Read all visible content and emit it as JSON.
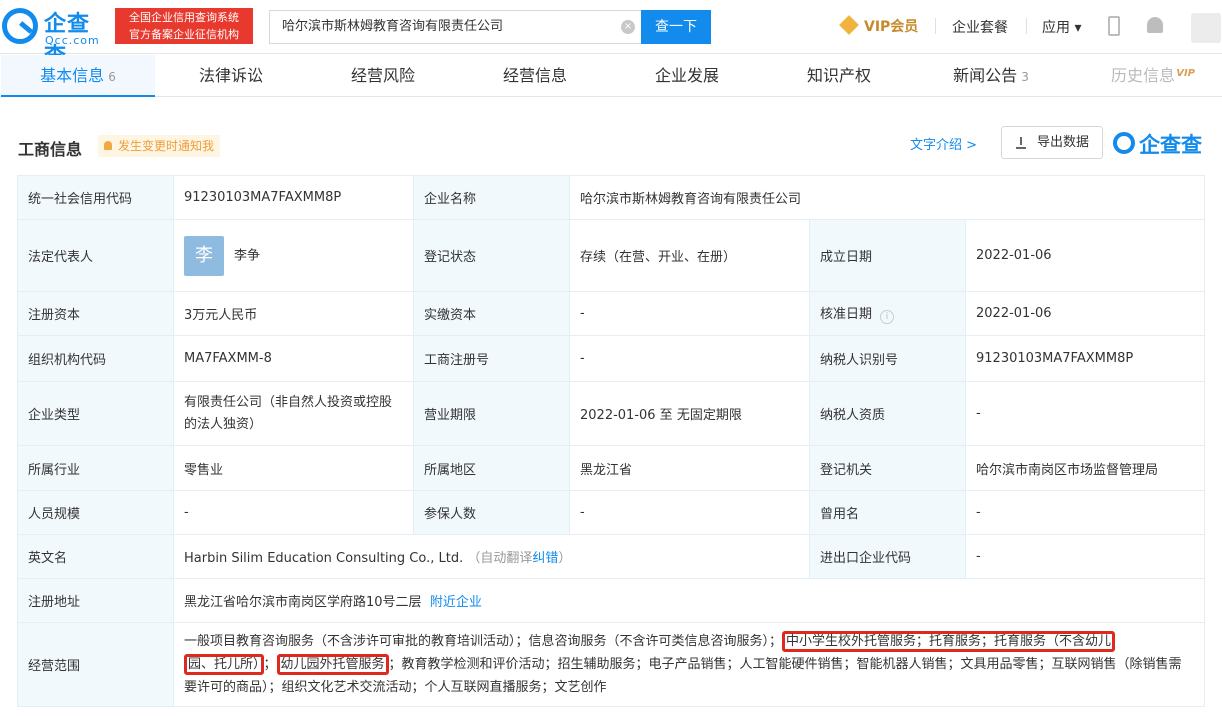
{
  "header": {
    "logo_title": "企查查",
    "logo_sub": "Qcc.com",
    "badge_line1": "全国企业信用查询系统",
    "badge_line2": "官方备案企业征信机构",
    "search_value": "哈尔滨市斯林姆教育咨询有限责任公司",
    "search_button": "查一下",
    "vip_label": "VIP会员",
    "enterprise_suite": "企业套餐",
    "apps": "应用 ▾"
  },
  "tabs": [
    {
      "label": "基本信息",
      "count": "6"
    },
    {
      "label": "法律诉讼",
      "count": ""
    },
    {
      "label": "经营风险",
      "count": ""
    },
    {
      "label": "经营信息",
      "count": ""
    },
    {
      "label": "企业发展",
      "count": ""
    },
    {
      "label": "知识产权",
      "count": ""
    },
    {
      "label": "新闻公告",
      "count": "3"
    },
    {
      "label": "历史信息",
      "count": "",
      "tag": "VIP"
    }
  ],
  "section": {
    "title": "工商信息",
    "notify": "发生变更时通知我",
    "text_intro": "文字介绍 >",
    "export": "导出数据",
    "brand": "企查查"
  },
  "info": {
    "credit_code_label": "统一社会信用代码",
    "credit_code": "91230103MA7FAXMM8P",
    "company_name_label": "企业名称",
    "company_name": "哈尔滨市斯林姆教育咨询有限责任公司",
    "legal_rep_label": "法定代表人",
    "legal_rep_avatar": "李",
    "legal_rep": "李争",
    "reg_status_label": "登记状态",
    "reg_status": "存续（在营、开业、在册）",
    "founded_label": "成立日期",
    "founded": "2022-01-06",
    "reg_capital_label": "注册资本",
    "reg_capital": "3万元人民币",
    "paid_capital_label": "实缴资本",
    "paid_capital": "-",
    "approval_date_label": "核准日期",
    "approval_date": "2022-01-06",
    "org_code_label": "组织机构代码",
    "org_code": "MA7FAXMM-8",
    "biz_reg_no_label": "工商注册号",
    "biz_reg_no": "-",
    "taxpayer_id_label": "纳税人识别号",
    "taxpayer_id": "91230103MA7FAXMM8P",
    "company_type_label": "企业类型",
    "company_type": "有限责任公司（非自然人投资或控股的法人独资）",
    "term_label": "营业期限",
    "term": "2022-01-06 至 无固定期限",
    "taxpayer_qual_label": "纳税人资质",
    "taxpayer_qual": "-",
    "industry_label": "所属行业",
    "industry": "零售业",
    "region_label": "所属地区",
    "region": "黑龙江省",
    "authority_label": "登记机关",
    "authority": "哈尔滨市南岗区市场监督管理局",
    "staff_label": "人员规模",
    "staff": "-",
    "insured_label": "参保人数",
    "insured": "-",
    "former_name_label": "曾用名",
    "former_name": "-",
    "english_label": "英文名",
    "english": "Harbin Silim Education Consulting Co., Ltd.",
    "auto_translate": "（自动翻译",
    "correct": "纠错",
    "auto_translate_close": "）",
    "ie_code_label": "进出口企业代码",
    "ie_code": "-",
    "address_label": "注册地址",
    "address": "黑龙江省哈尔滨市南岗区学府路10号二层",
    "nearby": "附近企业",
    "scope_label": "经营范围",
    "scope_a": "一般项目教育咨询服务（不含涉许可审批的教育培训活动）；信息咨询服务（不含许可类信息咨询服务）；",
    "scope_hl1": "中小学生校外托管服务；托育服务；托育服务（不含幼儿",
    "scope_hl1b": "园、托儿所）",
    "scope_b": "；",
    "scope_hl2": "幼儿园外托管服务",
    "scope_c": "；教育教学检测和评价活动；招生辅助服务；电子产品销售；人工智能硬件销售；智能机器人销售；文具用品零售；互联网销售（除销售需要许可的商品）；组织文化艺术交流活动；个人互联网直播服务；文艺创作"
  }
}
